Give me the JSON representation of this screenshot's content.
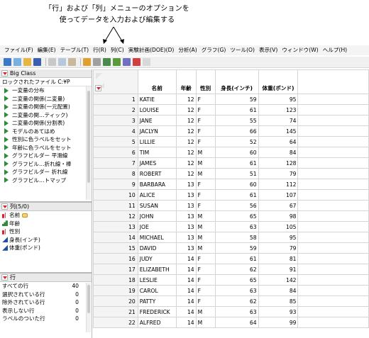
{
  "callout": {
    "line1": "「行」および「列」メニューのオプションを",
    "line2": "使ってデータを入力および編集する"
  },
  "menubar": [
    "ファイル(F)",
    "編集(E)",
    "テーブル(T)",
    "行(R)",
    "列(C)",
    "実験計画(DOE)(D)",
    "分析(A)",
    "グラフ(G)",
    "ツール(O)",
    "表示(V)",
    "ウィンドウ(W)",
    "ヘルプ(H)"
  ],
  "table_panel": {
    "title": "Big Class",
    "path": "ロックされたファイル C:¥P",
    "scripts": [
      "一変量の分布",
      "二変量の関係(二変量)",
      "二変量の関係(一元配置)",
      "二変量の関…ティック)",
      "二変量の関係(分割表)",
      "モデルのあてはめ",
      "性別に色ラベルをセット",
      "年齢に色ラベルをセット",
      "グラフビルダー 平滑線",
      "グラフビル…折れ線・棒",
      "グラフビルダー 折れ線",
      "グラフビル…トマップ"
    ]
  },
  "columns_panel": {
    "title": "列(5/0)",
    "items": [
      {
        "name": "名前",
        "type": "nominal",
        "label": true
      },
      {
        "name": "年齢",
        "type": "ordinal",
        "label": false
      },
      {
        "name": "性別",
        "type": "nominal",
        "label": false
      },
      {
        "name": "身長(インチ)",
        "type": "continuous",
        "label": false
      },
      {
        "name": "体重(ポンド)",
        "type": "continuous",
        "label": false
      }
    ]
  },
  "rows_panel": {
    "title": "行",
    "stats": [
      {
        "label": "すべての行",
        "value": "40"
      },
      {
        "label": "選択されている行",
        "value": "0"
      },
      {
        "label": "除外されている行",
        "value": "0"
      },
      {
        "label": "表示しない行",
        "value": "0"
      },
      {
        "label": "ラベルのついた行",
        "value": "0"
      }
    ]
  },
  "grid": {
    "headers": [
      "名前",
      "年齢",
      "性別",
      "身長(インチ)",
      "体重(ポンド)"
    ],
    "rows": [
      [
        "1",
        "KATIE",
        "12",
        "F",
        "59",
        "95"
      ],
      [
        "2",
        "LOUISE",
        "12",
        "F",
        "61",
        "123"
      ],
      [
        "3",
        "JANE",
        "12",
        "F",
        "55",
        "74"
      ],
      [
        "4",
        "JACLYN",
        "12",
        "F",
        "66",
        "145"
      ],
      [
        "5",
        "LILLIE",
        "12",
        "F",
        "52",
        "64"
      ],
      [
        "6",
        "TIM",
        "12",
        "M",
        "60",
        "84"
      ],
      [
        "7",
        "JAMES",
        "12",
        "M",
        "61",
        "128"
      ],
      [
        "8",
        "ROBERT",
        "12",
        "M",
        "51",
        "79"
      ],
      [
        "9",
        "BARBARA",
        "13",
        "F",
        "60",
        "112"
      ],
      [
        "10",
        "ALICE",
        "13",
        "F",
        "61",
        "107"
      ],
      [
        "11",
        "SUSAN",
        "13",
        "F",
        "56",
        "67"
      ],
      [
        "12",
        "JOHN",
        "13",
        "M",
        "65",
        "98"
      ],
      [
        "13",
        "JOE",
        "13",
        "M",
        "63",
        "105"
      ],
      [
        "14",
        "MICHAEL",
        "13",
        "M",
        "58",
        "95"
      ],
      [
        "15",
        "DAVID",
        "13",
        "M",
        "59",
        "79"
      ],
      [
        "16",
        "JUDY",
        "14",
        "F",
        "61",
        "81"
      ],
      [
        "17",
        "ELIZABETH",
        "14",
        "F",
        "62",
        "91"
      ],
      [
        "18",
        "LESLIE",
        "14",
        "F",
        "65",
        "142"
      ],
      [
        "19",
        "CAROL",
        "14",
        "F",
        "63",
        "84"
      ],
      [
        "20",
        "PATTY",
        "14",
        "F",
        "62",
        "85"
      ],
      [
        "21",
        "FREDERICK",
        "14",
        "M",
        "63",
        "93"
      ],
      [
        "22",
        "ALFRED",
        "14",
        "M",
        "64",
        "99"
      ]
    ]
  },
  "colors": {
    "accent_red": "#d8232a",
    "script_green": "#2e8b3a",
    "continuous_blue": "#1f4fa3"
  }
}
